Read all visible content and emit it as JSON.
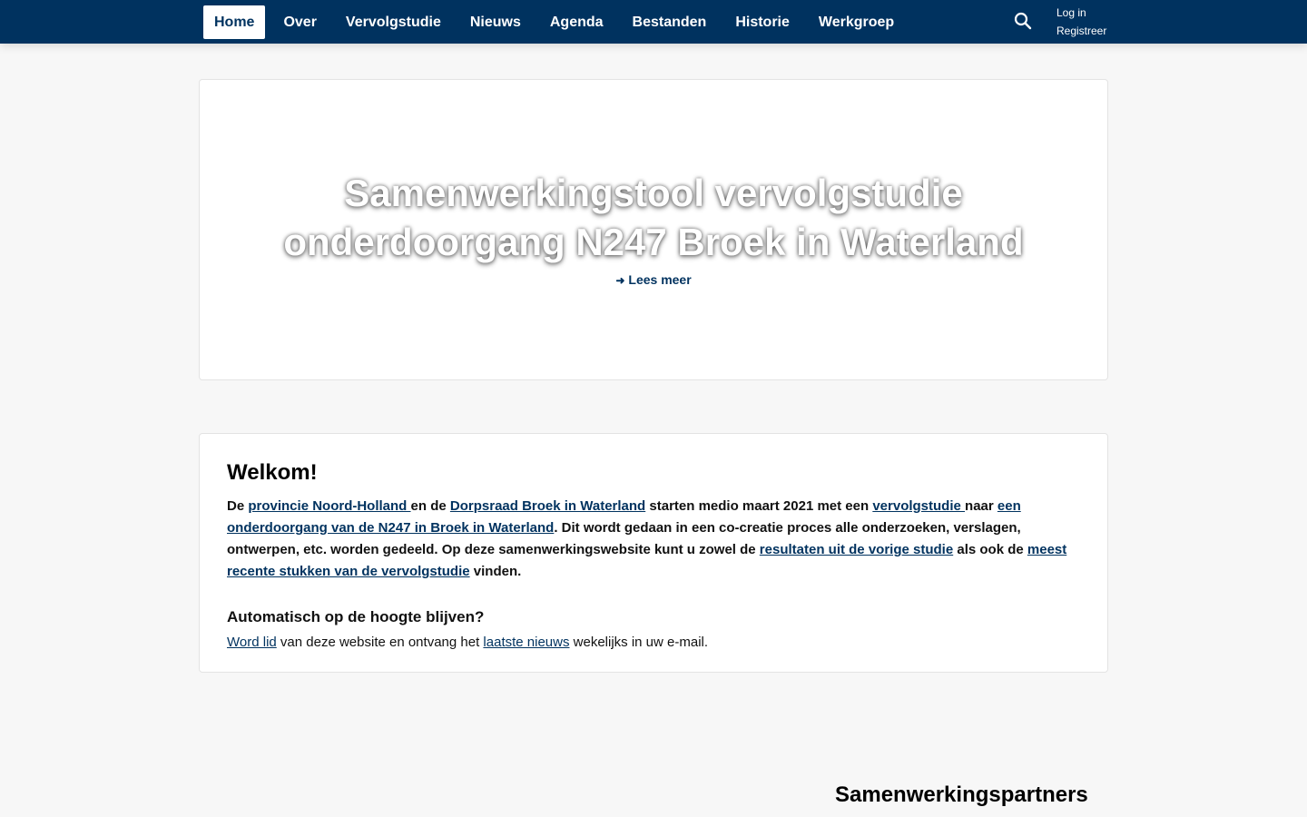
{
  "nav": {
    "items": [
      "Home",
      "Over",
      "Vervolgstudie",
      "Nieuws",
      "Agenda",
      "Bestanden",
      "Historie",
      "Werkgroep"
    ],
    "active": "Home"
  },
  "auth": {
    "login": "Log in",
    "register": "Registreer"
  },
  "hero": {
    "title_line1": "Samenwerkingstool vervolgstudie",
    "title_line2": "onderdoorgang N247 Broek in Waterland",
    "read_more": "Lees meer"
  },
  "welcome": {
    "heading": "Welkom!",
    "t1": "De ",
    "link_province": "provincie Noord-Holland ",
    "t2": "en de ",
    "link_dorpsraad": "Dorpsraad Broek in Waterland",
    "t3": " starten medio maart 2021 met een ",
    "link_vervolgstudie": "vervolgstudie ",
    "t4": "naar ",
    "link_onderdoorgang": "een onderdoorgang van de N247 in Broek in Waterland",
    "t5": ". Dit wordt gedaan in een co-creatie proces alle onderzoeken, verslagen, ontwerpen, etc. worden gedeeld. Op deze samenwerkingswebsite kunt u zowel de ",
    "link_resultaten": "resultaten uit de vorige studie",
    "t6": " als ook de ",
    "link_recent": "meest recente stukken van de vervolgstudie",
    "t7": " vinden.",
    "subheading": "Automatisch op de hoogte blijven?",
    "link_member": "Word lid",
    "t8": " van deze website en ontvang het ",
    "link_news": "laatste nieuws",
    "t9": " wekelijks in uw e-mail."
  },
  "partners": {
    "title": "Samenwerkingspartners"
  },
  "colors": {
    "brand": "#00325f",
    "background": "#f7f7f7",
    "card": "#ffffff"
  },
  "icons": {
    "search": "search-icon",
    "read_more": "arrow-right-icon"
  }
}
